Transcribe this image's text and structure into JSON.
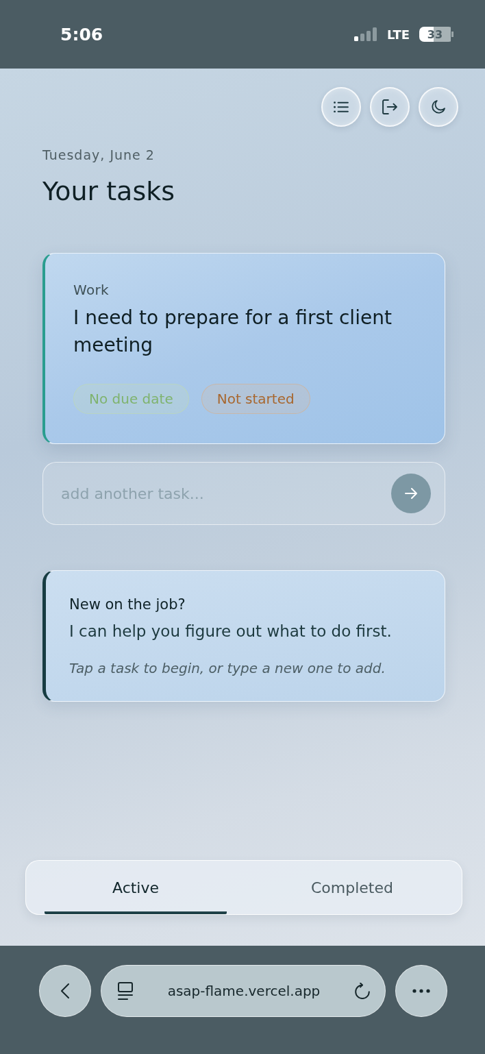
{
  "status_bar": {
    "time": "5:06",
    "network": "LTE",
    "battery": "33"
  },
  "header": {
    "date": "Tuesday, June 2",
    "title": "Your tasks"
  },
  "tasks": [
    {
      "category": "Work",
      "title": "I need to prepare for a first client meeting",
      "tags": [
        {
          "label": "No due date",
          "color": "#7fb36e"
        },
        {
          "label": "Not started",
          "color": "#a8672e"
        }
      ]
    }
  ],
  "new_task": {
    "placeholder": "add another task..."
  },
  "help_card": {
    "heading": "New on the job?",
    "body": "I can help you figure out what to do first.",
    "hint": "Tap a task to begin, or type a new one to add."
  },
  "tabs": [
    {
      "label": "Active",
      "selected": true
    },
    {
      "label": "Completed",
      "selected": false
    }
  ],
  "browser_bar": {
    "url": "asap-flame.vercel.app"
  }
}
